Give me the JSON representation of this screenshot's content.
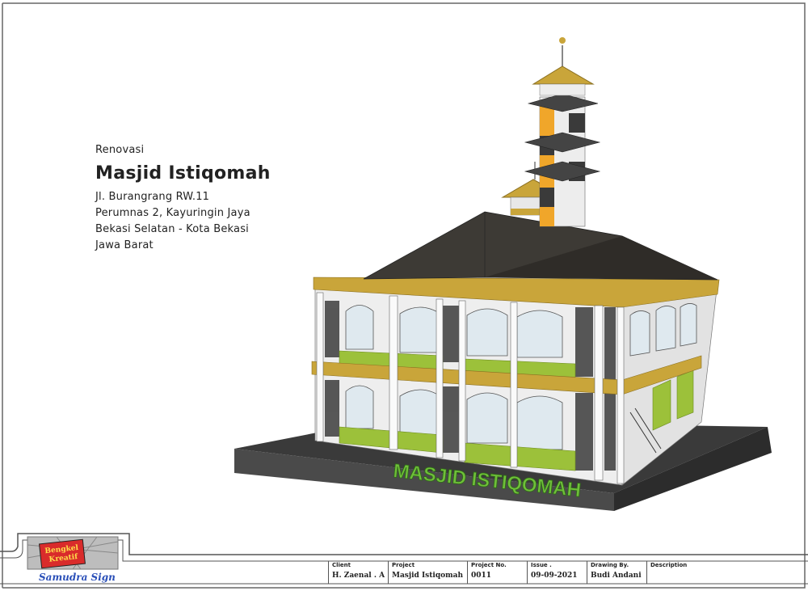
{
  "project_info": {
    "subtitle": "Renovasi",
    "title": "Masjid Istiqomah",
    "address_lines": [
      "Jl. Burangrang RW.11",
      "Perumnas 2, Kayuringin Jaya",
      "Bekasi Selatan - Kota Bekasi",
      "Jawa Barat"
    ]
  },
  "rendering": {
    "ground_text": "MASJID ISTIQOMAH",
    "colors": {
      "roof": "#3d3a35",
      "gold": "#c9a53a",
      "green": "#9cc13a",
      "base": "#3a3a3a",
      "sign_text": "#6fbf3a"
    }
  },
  "logo": {
    "tagline": "Bengkel Kreatif",
    "brand": "Samudra Sign"
  },
  "title_block": {
    "client_label": "Client",
    "client_value": "H. Zaenal . A",
    "project_label": "Project",
    "project_value": "Masjid Istiqomah",
    "project_no_label": "Project No.",
    "project_no_value": "0011",
    "issue_label": "Issue .",
    "issue_value": "09-09-2021",
    "drawing_by_label": "Drawing By.",
    "drawing_by_value": "Budi Andani",
    "description_label": "Description",
    "description_value": ""
  }
}
